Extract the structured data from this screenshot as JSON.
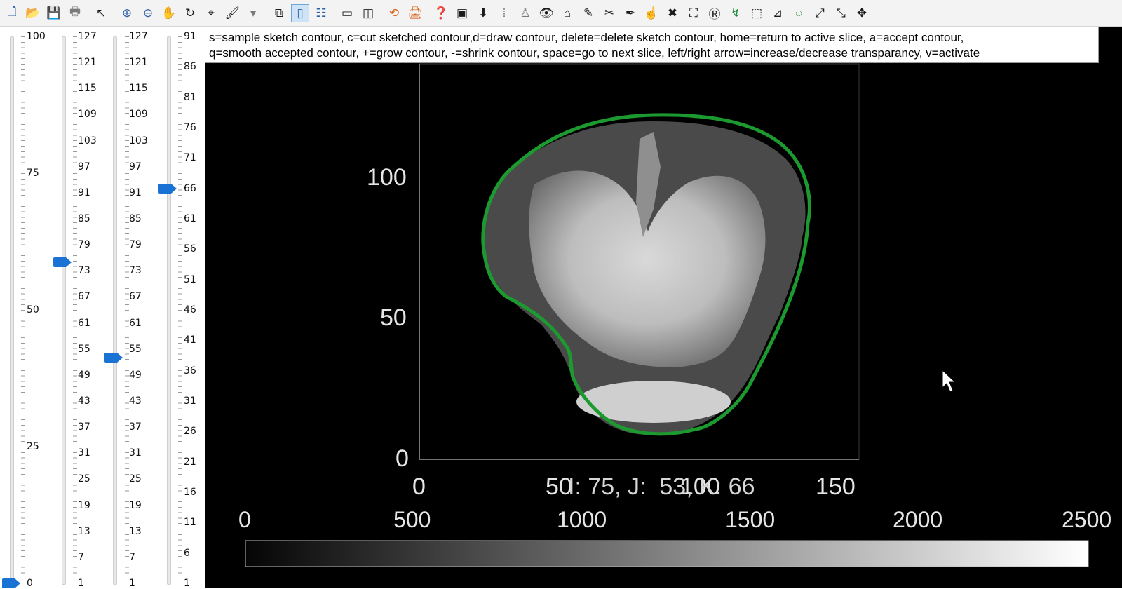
{
  "toolbar": {
    "tools": [
      {
        "name": "new-icon",
        "glyph": "🗋",
        "style": "blue"
      },
      {
        "name": "open-folder-icon",
        "glyph": "📂",
        "style": "orange"
      },
      {
        "name": "save-icon",
        "glyph": "💾",
        "style": "blue"
      },
      {
        "name": "print-icon",
        "glyph": "🖶",
        "style": "grey"
      },
      {
        "name": "sep"
      },
      {
        "name": "pointer-icon",
        "glyph": "↖",
        "style": ""
      },
      {
        "name": "sep"
      },
      {
        "name": "zoom-in-icon",
        "glyph": "⊕",
        "style": "blue"
      },
      {
        "name": "zoom-out-icon",
        "glyph": "⊖",
        "style": "blue"
      },
      {
        "name": "pan-hand-icon",
        "glyph": "✋",
        "style": ""
      },
      {
        "name": "rotate-3d-icon",
        "glyph": "↻",
        "style": ""
      },
      {
        "name": "data-cursor-icon",
        "glyph": "⌖",
        "style": ""
      },
      {
        "name": "brush-icon",
        "glyph": "🖌",
        "style": ""
      },
      {
        "name": "dropdown-arrow-icon",
        "glyph": "▾",
        "style": "grey"
      },
      {
        "name": "sep"
      },
      {
        "name": "link-plot-icon",
        "glyph": "⧉",
        "style": ""
      },
      {
        "name": "colorbar-icon",
        "glyph": "▯",
        "style": "blue",
        "active": true
      },
      {
        "name": "legend-icon",
        "glyph": "☷",
        "style": "blue"
      },
      {
        "name": "sep"
      },
      {
        "name": "single-view-icon",
        "glyph": "▭",
        "style": ""
      },
      {
        "name": "multi-view-icon",
        "glyph": "◫",
        "style": ""
      },
      {
        "name": "sep"
      },
      {
        "name": "refresh-icon",
        "glyph": "⟲",
        "style": "orange"
      },
      {
        "name": "print-figure-icon",
        "glyph": "🖨",
        "style": "orange"
      },
      {
        "name": "sep"
      },
      {
        "name": "help-icon",
        "glyph": "❓",
        "style": ""
      },
      {
        "name": "save-contour-icon",
        "glyph": "▣",
        "style": ""
      },
      {
        "name": "download-icon",
        "glyph": "⬇",
        "style": ""
      },
      {
        "name": "split-icon",
        "glyph": "⁞",
        "style": "grey"
      },
      {
        "name": "ghost-icon",
        "glyph": "♙",
        "style": "grey"
      },
      {
        "name": "eye-icon",
        "glyph": "👁",
        "style": ""
      },
      {
        "name": "home-icon",
        "glyph": "⌂",
        "style": ""
      },
      {
        "name": "eyedropper-icon",
        "glyph": "✎",
        "style": ""
      },
      {
        "name": "scissors-icon",
        "glyph": "✂",
        "style": ""
      },
      {
        "name": "pen-icon",
        "glyph": "✒",
        "style": ""
      },
      {
        "name": "grab-hand-icon",
        "glyph": "☝",
        "style": ""
      },
      {
        "name": "delete-x-icon",
        "glyph": "✖",
        "style": ""
      },
      {
        "name": "crop-icon",
        "glyph": "⛶",
        "style": ""
      },
      {
        "name": "region-r-icon",
        "glyph": "Ⓡ",
        "style": ""
      },
      {
        "name": "grow-contour-icon",
        "glyph": "↯",
        "style": "green"
      },
      {
        "name": "select-box-icon",
        "glyph": "⬚",
        "style": ""
      },
      {
        "name": "measure-icon",
        "glyph": "⊿",
        "style": ""
      },
      {
        "name": "contour-loop-icon",
        "glyph": "◌",
        "style": "green"
      },
      {
        "name": "expand-icon",
        "glyph": "⤢",
        "style": ""
      },
      {
        "name": "collapse-icon",
        "glyph": "⤡",
        "style": ""
      },
      {
        "name": "move-icon",
        "glyph": "✥",
        "style": ""
      }
    ]
  },
  "sliders": {
    "s1": {
      "labels": [
        "100",
        "75",
        "50",
        "25",
        "0"
      ],
      "value": 0
    },
    "s2": {
      "labels": [
        "127",
        "121",
        "115",
        "109",
        "103",
        "97",
        "91",
        "85",
        "79",
        "73",
        "67",
        "61",
        "55",
        "49",
        "43",
        "37",
        "31",
        "25",
        "19",
        "13",
        "7",
        "1"
      ],
      "value": 75
    },
    "s3": {
      "labels": [
        "127",
        "121",
        "115",
        "109",
        "103",
        "97",
        "91",
        "85",
        "79",
        "73",
        "67",
        "61",
        "55",
        "49",
        "43",
        "37",
        "31",
        "25",
        "19",
        "13",
        "7",
        "1"
      ],
      "value": 53
    },
    "s4": {
      "labels": [
        "91",
        "86",
        "81",
        "76",
        "71",
        "66",
        "61",
        "56",
        "51",
        "46",
        "41",
        "36",
        "31",
        "26",
        "21",
        "16",
        "11",
        "6",
        "1"
      ],
      "value": 66
    }
  },
  "help": {
    "line1": "s=sample sketch contour, c=cut sketched contour,d=draw contour, delete=delete sketch contour, home=return to active slice, a=accept contour,",
    "line2": "q=smooth accepted contour, +=grow contour, -=shrink contour, space=go to next slice, left/right arrow=increase/decrease transparancy, v=activate"
  },
  "axes": {
    "yticks": [
      "100",
      "50",
      "0"
    ],
    "xticks": [
      "0",
      "50",
      "100",
      "150"
    ],
    "readout": "I: 75, J:  53, K: 66"
  },
  "colorbar": {
    "ticks": [
      "0",
      "500",
      "1000",
      "1500",
      "2000",
      "2500"
    ]
  },
  "colors": {
    "contour": "#1c9a2f",
    "accent": "#1a73d4"
  }
}
